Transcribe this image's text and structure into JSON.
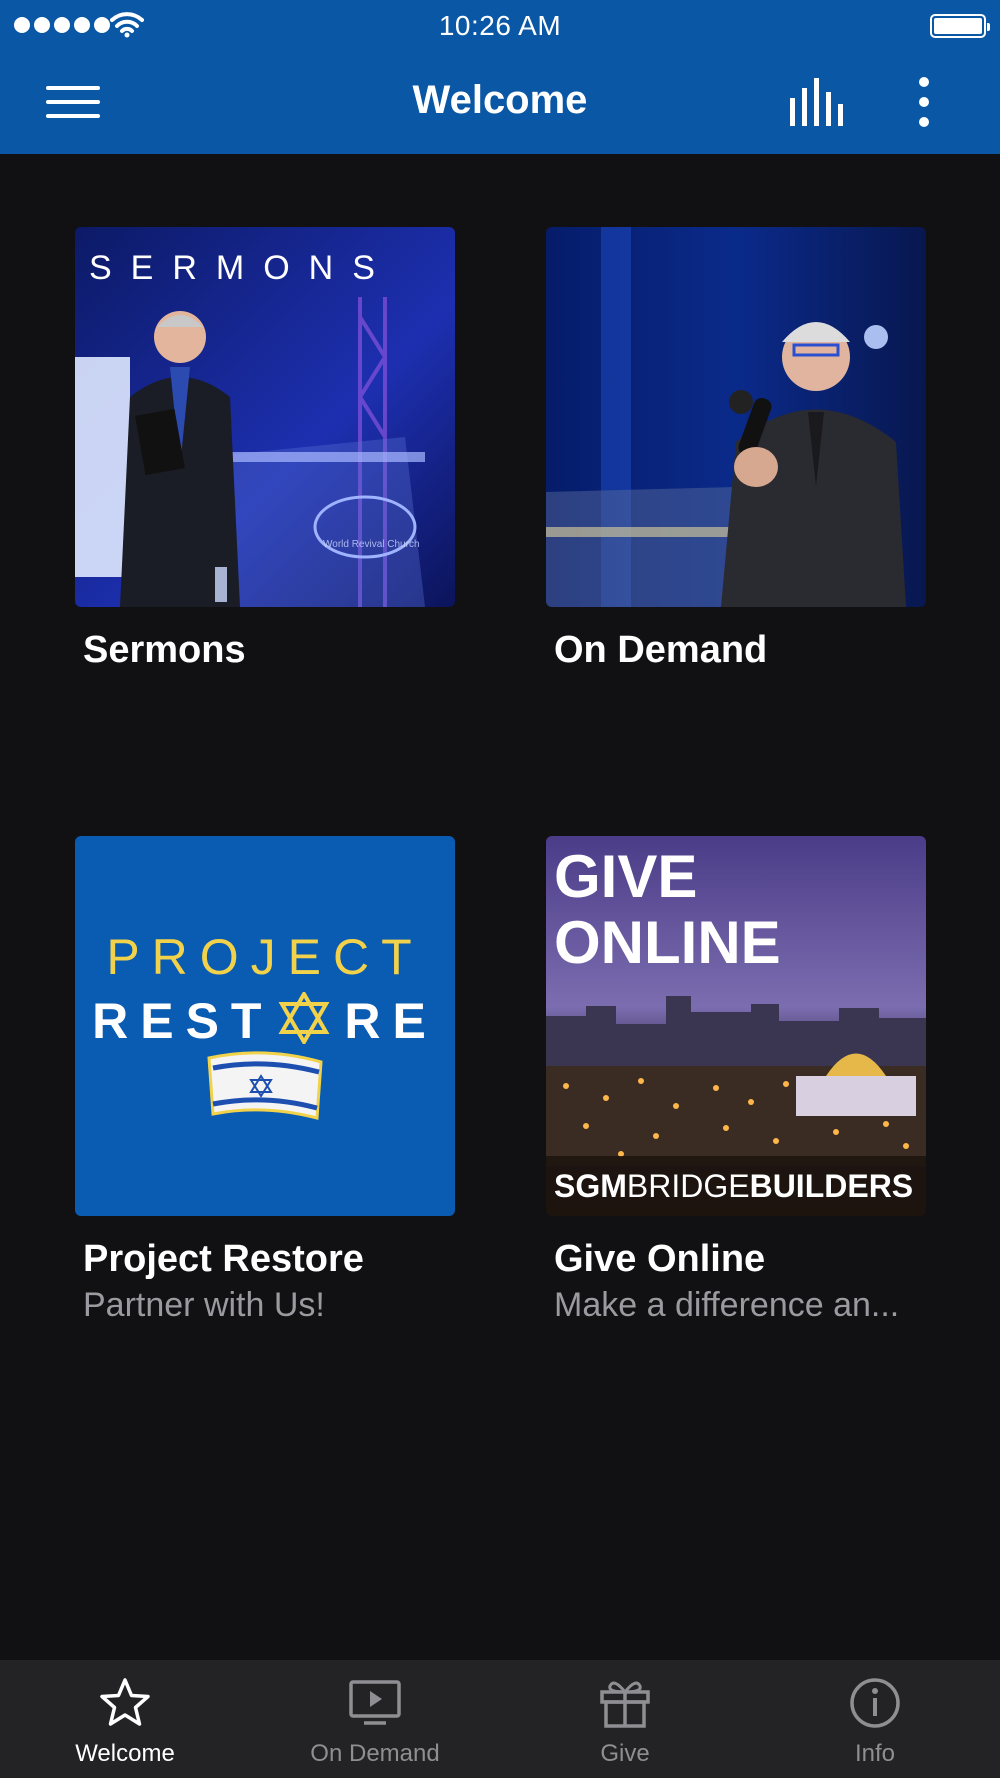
{
  "status_bar": {
    "time": "10:26 AM",
    "icons": [
      "signal-dots-icon",
      "wifi-icon",
      "battery-icon"
    ]
  },
  "nav": {
    "title": "Welcome",
    "icons": [
      "hamburger-menu-icon",
      "bar-chart-icon",
      "more-vertical-icon"
    ]
  },
  "cards": [
    {
      "title": "Sermons",
      "subtitle": "",
      "image_text": "SERMONS",
      "image_caption": "World Revival Church"
    },
    {
      "title": "On Demand",
      "subtitle": ""
    },
    {
      "title": "Project Restore",
      "subtitle": "Partner with Us!",
      "image_line1": "PROJECT",
      "image_line2a": "REST",
      "image_line2b": "RE"
    },
    {
      "title": "Give Online",
      "subtitle": "Make a difference an...",
      "image_line1": "GIVE",
      "image_line2": "ONLINE",
      "image_footer_a": "SGM",
      "image_footer_b": "BRIDGE",
      "image_footer_c": "BUILDERS"
    }
  ],
  "tabs": [
    {
      "label": "Welcome",
      "icon": "star-icon",
      "active": true
    },
    {
      "label": "On Demand",
      "icon": "play-screen-icon",
      "active": false
    },
    {
      "label": "Give",
      "icon": "gift-icon",
      "active": false
    },
    {
      "label": "Info",
      "icon": "info-icon",
      "active": false
    }
  ],
  "colors": {
    "nav_blue": "#0a57a6",
    "background": "#111113",
    "tabbar": "#232325",
    "inactive_tab": "#8e8e93",
    "project_blue": "#0a5bb2",
    "project_yellow": "#f2d24a"
  }
}
